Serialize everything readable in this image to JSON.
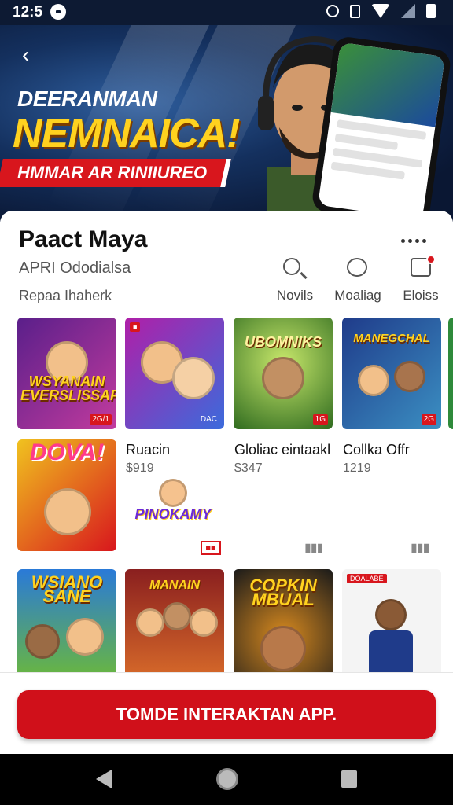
{
  "status": {
    "time": "12:5"
  },
  "hero": {
    "line1": "DEERANMAN",
    "line2": "NEMNAICA!",
    "line3": "HMMAR AR RINIIUREO"
  },
  "app": {
    "title": "Paact Maya",
    "subtitle": "APRI Ododialsa",
    "rating_text": "Repaa Ihaherk"
  },
  "actions": [
    {
      "label": "Novils",
      "icon": "search-icon"
    },
    {
      "label": "Moaliag",
      "icon": "chat-bubble-icon"
    },
    {
      "label": "Eloiss",
      "icon": "message-icon"
    }
  ],
  "games": {
    "row1": [
      {
        "title": "WSYANAIN EVERSLISSAFE",
        "badge": "2G/1",
        "colors": [
          "#5a1f8a",
          "#c23b9e"
        ]
      },
      {
        "title": "",
        "badge": "DAC",
        "colors": [
          "#b01fa8",
          "#3b6bdc"
        ]
      },
      {
        "title": "UBOMNIKS",
        "badge": "1G",
        "colors": [
          "#2f6b1f",
          "#8fc23b"
        ]
      },
      {
        "title": "MANEGCHAL",
        "badge": "2G",
        "colors": [
          "#1f3b8a",
          "#3b8fc2"
        ]
      }
    ],
    "row2_tile": {
      "title": "DOVA!",
      "colors": [
        "#f08a1f",
        "#d8161d"
      ]
    },
    "row2_tile2": {
      "title": "PINOKAMY"
    },
    "row2_info": [
      {
        "name": "Ruacin",
        "price": "$919"
      },
      {
        "name": "Gloliac eintaakl",
        "price": "$347"
      },
      {
        "name": "Collka Offr",
        "price": "1219"
      }
    ],
    "row3": [
      {
        "title": "WSIANO SANE",
        "colors": [
          "#2a7ad8",
          "#6bb83b"
        ]
      },
      {
        "title": "MANAIN",
        "colors": [
          "#8a1f1f",
          "#d86b2a"
        ]
      },
      {
        "title": "COPKIN MBUAL",
        "colors": [
          "#1a1a1a",
          "#d88a1f"
        ]
      },
      {
        "title": "",
        "colors": [
          "#e8e8e8",
          "#ffffff"
        ],
        "tag": "DOALABE"
      }
    ]
  },
  "cta": {
    "label": "TOMDE INTERAKTAN APP."
  }
}
